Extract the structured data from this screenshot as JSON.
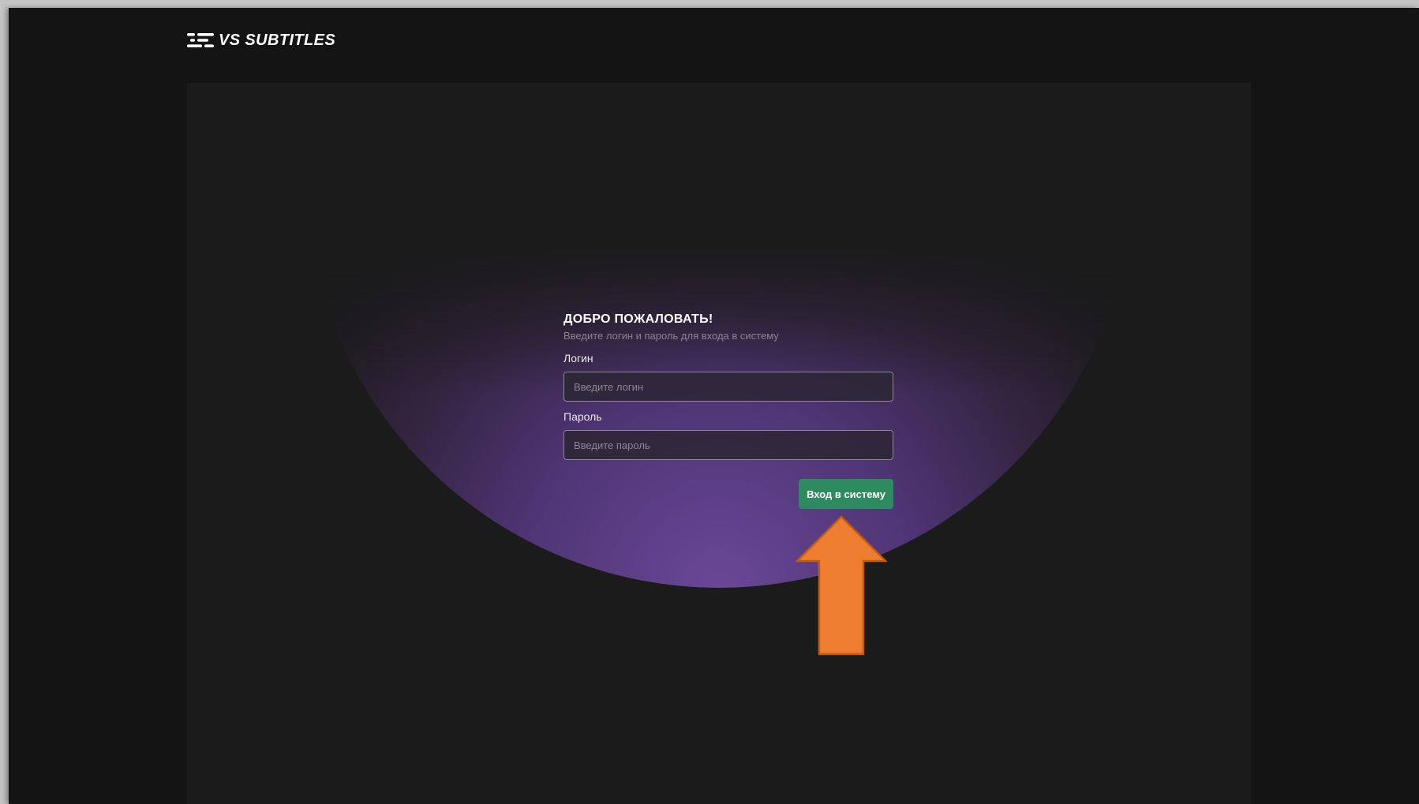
{
  "brand": {
    "name": "VS SUBTITLES",
    "logo_icon": "subtitles-lines-icon"
  },
  "login_form": {
    "title": "ДОБРО ПОЖАЛОВАТЬ!",
    "subtitle": "Введите логин и пароль для входа в систему",
    "login_label": "Логин",
    "login_placeholder": "Введите логин",
    "login_value": "",
    "password_label": "Пароль",
    "password_placeholder": "Введите пароль",
    "password_value": "",
    "submit_label": "Вход в систему"
  },
  "annotation": {
    "icon": "arrow-up-icon"
  },
  "colors": {
    "background": "#141414",
    "panel": "#1b1b1b",
    "glow": "#6a4796",
    "button": "#2e8a5f",
    "arrow_fill": "#ed7d31",
    "arrow_stroke": "#c55a11"
  }
}
